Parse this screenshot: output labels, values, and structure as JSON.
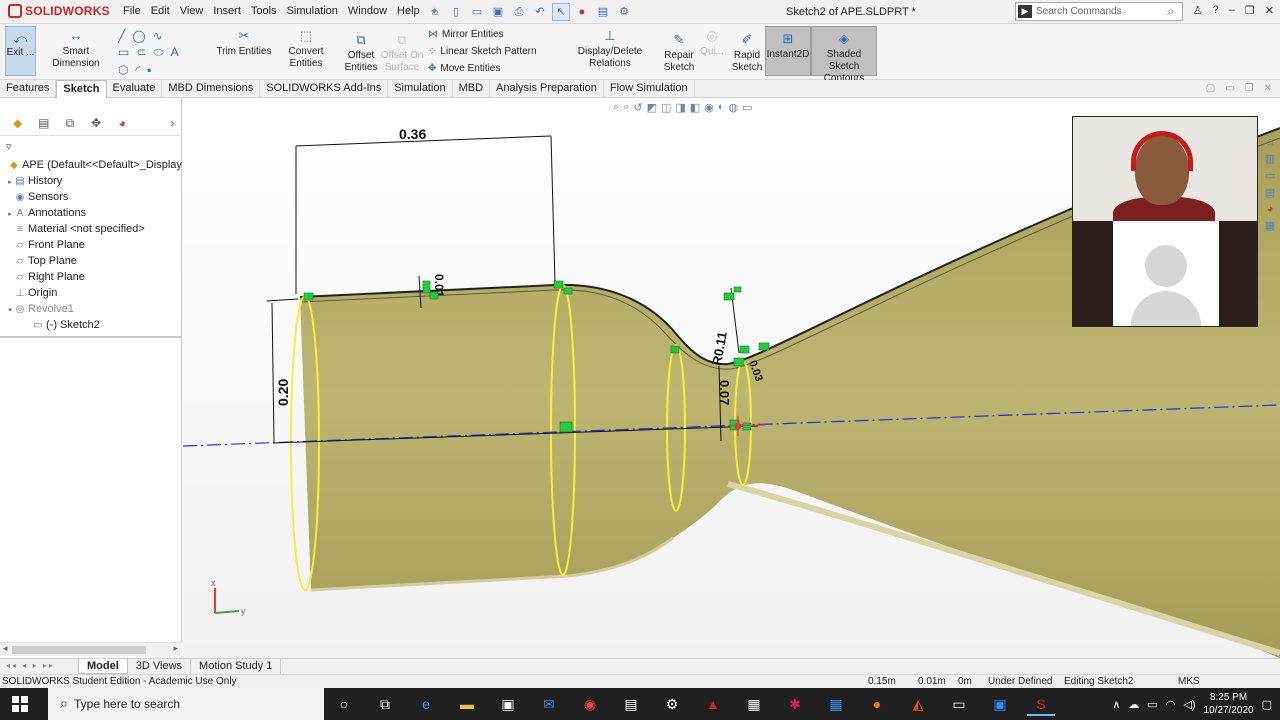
{
  "app": {
    "logo_text": "SOLIDWORKS",
    "menu": [
      "File",
      "Edit",
      "View",
      "Insert",
      "Tools",
      "Simulation",
      "Window",
      "Help"
    ],
    "document_title": "Sketch2 of APE.SLDPRT *",
    "search_placeholder": "Search Commands"
  },
  "command_manager": {
    "exit_sketch": "Exit ...",
    "smart_dimension": "Smart Dimension",
    "trim_entities": "Trim Entities",
    "convert_entities": "Convert Entities",
    "offset_entities_1": "Offset",
    "offset_entities_2": "Entities",
    "offset_on_surface_1": "Offset On",
    "offset_on_surface_2": "Surface",
    "mirror_entities": "Mirror Entities",
    "linear_sketch_pattern": "Linear Sketch Pattern",
    "move_entities": "Move Entities",
    "display_delete_relations": "Display/Delete Relations",
    "repair_sketch_1": "Repair",
    "repair_sketch_2": "Sketch",
    "quick_snaps": "Qui...",
    "rapid_sketch_1": "Rapid",
    "rapid_sketch_2": "Sketch",
    "instant2d": "Instant2D",
    "shaded_contours_1": "Shaded Sketch",
    "shaded_contours_2": "Contours"
  },
  "tabs": [
    "Features",
    "Sketch",
    "Evaluate",
    "MBD Dimensions",
    "SOLIDWORKS Add-Ins",
    "Simulation",
    "MBD",
    "Analysis Preparation",
    "Flow Simulation"
  ],
  "active_tab": "Sketch",
  "feature_tree": {
    "root": "APE  (Default<<Default>_Display",
    "items": [
      {
        "label": "History",
        "expand": "▸",
        "icon": "▤"
      },
      {
        "label": "Sensors",
        "expand": "",
        "icon": "◉"
      },
      {
        "label": "Annotations",
        "expand": "▸",
        "icon": "A"
      },
      {
        "label": "Material <not specified>",
        "expand": "",
        "icon": "≡"
      },
      {
        "label": "Front Plane",
        "expand": "",
        "icon": "▱"
      },
      {
        "label": "Top Plane",
        "expand": "",
        "icon": "▱"
      },
      {
        "label": "Right Plane",
        "expand": "",
        "icon": "▱"
      },
      {
        "label": "Origin",
        "expand": "",
        "icon": "⊥"
      },
      {
        "label": "Revolve1",
        "expand": "▾",
        "icon": "◎"
      },
      {
        "label": "(-) Sketch2",
        "expand": "",
        "icon": "▭"
      }
    ]
  },
  "viewport": {
    "dimensions": [
      "0.36",
      "0.20",
      "0.01",
      "R0.11",
      "0.07",
      "0.03"
    ]
  },
  "bottom_tabs": [
    "Model",
    "3D Views",
    "Motion Study 1"
  ],
  "active_bottom_tab": "Model",
  "status_bar": {
    "edition": "SOLIDWORKS Student Edition - Academic Use Only",
    "x": "0.15m",
    "y": "0.01m",
    "z": "0m",
    "state": "Under Defined",
    "editing": "Editing Sketch2",
    "units": "MKS"
  },
  "taskbar": {
    "search_placeholder": "Type here to search",
    "time": "8:25 PM",
    "date": "10/27/2020"
  },
  "colors": {
    "body_fill": "#b9b26e",
    "sketch_yellow": "#f4ee3c",
    "centerline": "#1f2fd6",
    "relation_green": "#27c93f"
  }
}
